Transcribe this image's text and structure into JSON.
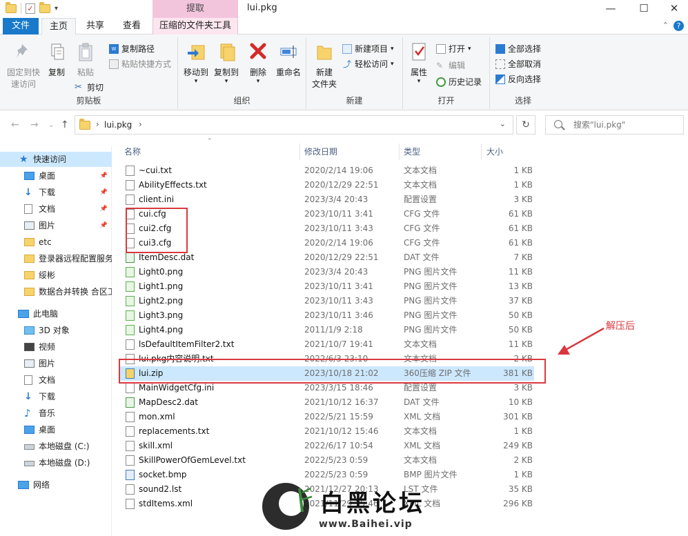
{
  "window": {
    "title": "lui.pkg",
    "context_tab_header": "提取",
    "minimize": "—",
    "maximize": "☐",
    "close": "✕"
  },
  "tabs": {
    "file": "文件",
    "home": "主页",
    "share": "共享",
    "view": "查看",
    "context": "压缩的文件夹工具"
  },
  "ribbon": {
    "clipboard": {
      "label": "剪贴板",
      "pin_line1": "固定到快",
      "pin_line2": "速访问",
      "copy": "复制",
      "paste": "粘贴",
      "copy_path": "复制路径",
      "paste_shortcut": "粘贴快捷方式",
      "cut": "剪切"
    },
    "organize": {
      "label": "组织",
      "move_to": "移动到",
      "copy_to": "复制到",
      "delete": "删除",
      "rename": "重命名"
    },
    "new": {
      "label": "新建",
      "new_folder_line1": "新建",
      "new_folder_line2": "文件夹",
      "new_item": "新建项目",
      "easy_access": "轻松访问"
    },
    "open": {
      "label": "打开",
      "properties": "属性",
      "open": "打开",
      "edit": "编辑",
      "history": "历史记录"
    },
    "select": {
      "label": "选择",
      "select_all": "全部选择",
      "select_none": "全部取消",
      "invert": "反向选择"
    }
  },
  "address": {
    "path": "lui.pkg",
    "search_placeholder": "搜索\"lui.pkg\""
  },
  "nav": {
    "quick_access": "快速访问",
    "pinned": [
      {
        "label": "桌面"
      },
      {
        "label": "下载"
      },
      {
        "label": "文档"
      },
      {
        "label": "图片"
      }
    ],
    "recent": [
      {
        "label": "etc"
      },
      {
        "label": "登录器远程配置服务"
      },
      {
        "label": "绥彬"
      },
      {
        "label": "数据合并转换 合区工"
      }
    ],
    "this_pc": "此电脑",
    "pc_items": [
      {
        "label": "3D 对象"
      },
      {
        "label": "视频"
      },
      {
        "label": "图片"
      },
      {
        "label": "文档"
      },
      {
        "label": "下载"
      },
      {
        "label": "音乐"
      },
      {
        "label": "桌面"
      },
      {
        "label": "本地磁盘 (C:)"
      },
      {
        "label": "本地磁盘 (D:)"
      }
    ],
    "network": "网络"
  },
  "columns": {
    "name": "名称",
    "date": "修改日期",
    "type": "类型",
    "size": "大小"
  },
  "files": [
    {
      "name": "~cui.txt",
      "date": "2020/2/14 19:06",
      "type": "文本文档",
      "size": "1 KB",
      "icon": "doc"
    },
    {
      "name": "AbilityEffects.txt",
      "date": "2020/12/29 22:51",
      "type": "文本文档",
      "size": "1 KB",
      "icon": "doc"
    },
    {
      "name": "client.ini",
      "date": "2023/3/4 20:43",
      "type": "配置设置",
      "size": "3 KB",
      "icon": "doc"
    },
    {
      "name": "cui.cfg",
      "date": "2023/10/11 3:41",
      "type": "CFG 文件",
      "size": "61 KB",
      "icon": "doc"
    },
    {
      "name": "cui2.cfg",
      "date": "2023/10/11 3:43",
      "type": "CFG 文件",
      "size": "61 KB",
      "icon": "doc"
    },
    {
      "name": "cui3.cfg",
      "date": "2020/2/14 19:06",
      "type": "CFG 文件",
      "size": "61 KB",
      "icon": "doc"
    },
    {
      "name": "ItemDesc.dat",
      "date": "2020/12/29 22:51",
      "type": "DAT 文件",
      "size": "7 KB",
      "icon": "dat"
    },
    {
      "name": "Light0.png",
      "date": "2023/3/4 20:43",
      "type": "PNG 图片文件",
      "size": "11 KB",
      "icon": "img"
    },
    {
      "name": "Light1.png",
      "date": "2023/10/11 3:41",
      "type": "PNG 图片文件",
      "size": "13 KB",
      "icon": "img"
    },
    {
      "name": "Light2.png",
      "date": "2023/10/11 3:43",
      "type": "PNG 图片文件",
      "size": "37 KB",
      "icon": "img"
    },
    {
      "name": "Light3.png",
      "date": "2023/10/11 3:46",
      "type": "PNG 图片文件",
      "size": "50 KB",
      "icon": "img"
    },
    {
      "name": "Light4.png",
      "date": "2011/1/9 2:18",
      "type": "PNG 图片文件",
      "size": "50 KB",
      "icon": "img"
    },
    {
      "name": "lsDefaultItemFilter2.txt",
      "date": "2021/10/7 19:41",
      "type": "文本文档",
      "size": "11 KB",
      "icon": "doc"
    },
    {
      "name": "lui.pkg内容说明.txt",
      "date": "2022/6/3 23:10",
      "type": "文本文档",
      "size": "2 KB",
      "icon": "doc"
    },
    {
      "name": "lui.zip",
      "date": "2023/10/18 21:02",
      "type": "360压缩 ZIP 文件",
      "size": "381 KB",
      "icon": "zip"
    },
    {
      "name": "MainWidgetCfg.ini",
      "date": "2023/3/15 18:46",
      "type": "配置设置",
      "size": "3 KB",
      "icon": "doc"
    },
    {
      "name": "MapDesc2.dat",
      "date": "2021/10/12 16:37",
      "type": "DAT 文件",
      "size": "10 KB",
      "icon": "dat"
    },
    {
      "name": "mon.xml",
      "date": "2022/5/21 15:59",
      "type": "XML 文档",
      "size": "301 KB",
      "icon": "doc"
    },
    {
      "name": "replacements.txt",
      "date": "2021/10/12 15:46",
      "type": "文本文档",
      "size": "1 KB",
      "icon": "doc"
    },
    {
      "name": "skill.xml",
      "date": "2022/6/17 10:54",
      "type": "XML 文档",
      "size": "249 KB",
      "icon": "doc"
    },
    {
      "name": "SkillPowerOfGemLevel.txt",
      "date": "2022/5/23 0:59",
      "type": "文本文档",
      "size": "2 KB",
      "icon": "doc"
    },
    {
      "name": "socket.bmp",
      "date": "2022/5/23 0:59",
      "type": "BMP 图片文件",
      "size": "1 KB",
      "icon": "bmp"
    },
    {
      "name": "sound2.lst",
      "date": "2021/12/27 20:13",
      "type": "LST 文件",
      "size": "35 KB",
      "icon": "doc"
    },
    {
      "name": "stdItems.xml",
      "date": "2021/11/29 15:46",
      "type": "XML 文档",
      "size": "296 KB",
      "icon": "doc"
    }
  ],
  "selected_index": 14,
  "annotation": {
    "text": "解压后",
    "color": "#d9383e"
  },
  "watermark": {
    "brand_text": "白黑论坛",
    "url": "www.Baihei.vip"
  },
  "colors": {
    "accent": "#1979ca",
    "selection": "#cce8ff",
    "context_tab": "#f3c5dd"
  }
}
